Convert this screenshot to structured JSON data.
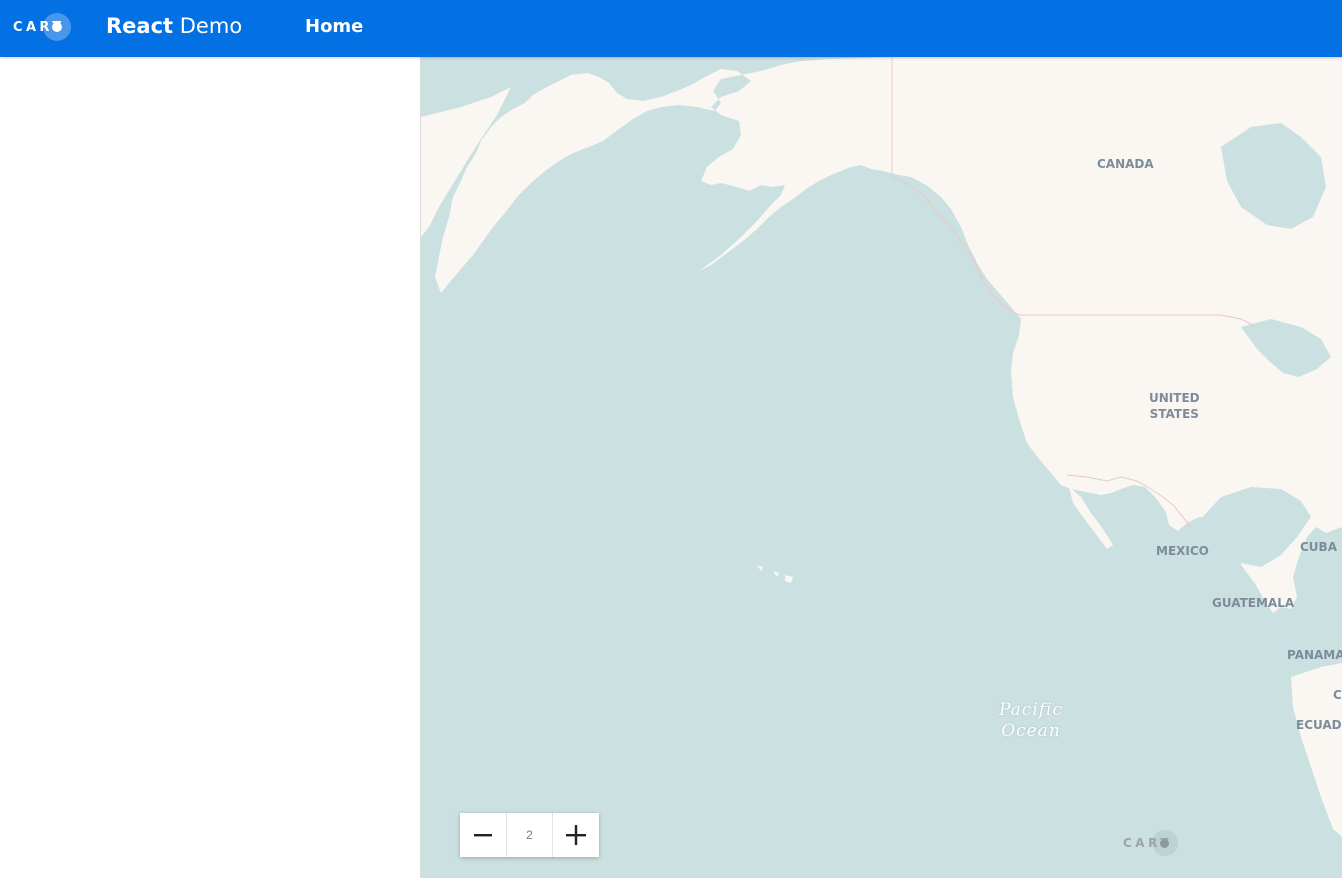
{
  "header": {
    "logo_text": "CART",
    "title_bold": "React",
    "title_light": "Demo",
    "nav_home": "Home"
  },
  "map": {
    "labels": {
      "canada": "CANADA",
      "united_states": "UNITED\nSTATES",
      "mexico": "MEXICO",
      "cuba": "CUBA",
      "guatemala": "GUATEMALA",
      "panama": "PANAMA",
      "ecuador": "ECUAD",
      "colombia": "C",
      "pacific_ocean": "Pacific\nOcean"
    },
    "zoom_level": "2",
    "watermark": "CART"
  },
  "colors": {
    "appbar": "#0370e3",
    "water": "#cbe0e1",
    "land": "#faf7f3",
    "border": "#e9c8c8"
  }
}
